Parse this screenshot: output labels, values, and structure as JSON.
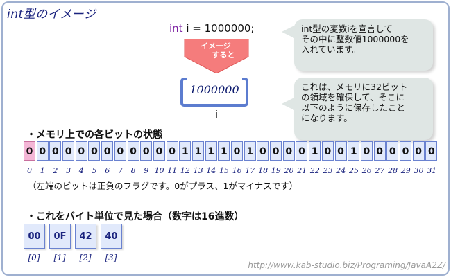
{
  "title": "int型のイメージ",
  "code": {
    "keyword": "int",
    "rest": " i = 1000000;"
  },
  "bubble1": {
    "line1": "int型の変数iを宣言して",
    "line2": "その中に整数値1000000を",
    "line3": "入れています。"
  },
  "bubble2": {
    "line1": "これは、メモリに32ビット",
    "line2": "の領域を確保して、そこに",
    "line3": "以下のように保存したこと",
    "line4": "になります。"
  },
  "arrow": {
    "line1": "イメージ",
    "line2": "すると",
    "color": "#f57c7c"
  },
  "variable": {
    "value": "1000000",
    "name": "i"
  },
  "bits_section": {
    "heading": "・メモリ上での各ビットの状態",
    "bits": [
      "0",
      "0",
      "0",
      "0",
      "0",
      "0",
      "0",
      "0",
      "0",
      "0",
      "0",
      "0",
      "1",
      "1",
      "1",
      "1",
      "0",
      "1",
      "0",
      "0",
      "0",
      "0",
      "1",
      "0",
      "0",
      "1",
      "0",
      "0",
      "0",
      "0",
      "0",
      "0"
    ],
    "indices": [
      "0",
      "1",
      "2",
      "3",
      "4",
      "5",
      "6",
      "7",
      "8",
      "9",
      "10",
      "11",
      "12",
      "13",
      "14",
      "15",
      "16",
      "17",
      "18",
      "19",
      "20",
      "21",
      "22",
      "23",
      "24",
      "25",
      "26",
      "27",
      "28",
      "29",
      "30",
      "31"
    ],
    "note": "（左端のビットは正負のフラグです。0がプラス、1がマイナスです）",
    "sign_color": "#f4b6d6",
    "cell_color": "#e1e9fb"
  },
  "bytes_section": {
    "heading": "・これをバイト単位で見た場合（数字は16進数）",
    "bytes": [
      "00",
      "0F",
      "42",
      "40"
    ],
    "indices": [
      "[0]",
      "[1]",
      "[2]",
      "[3]"
    ]
  },
  "url": "http://www.kab-studio.biz/Programing/JavaA2Z/"
}
